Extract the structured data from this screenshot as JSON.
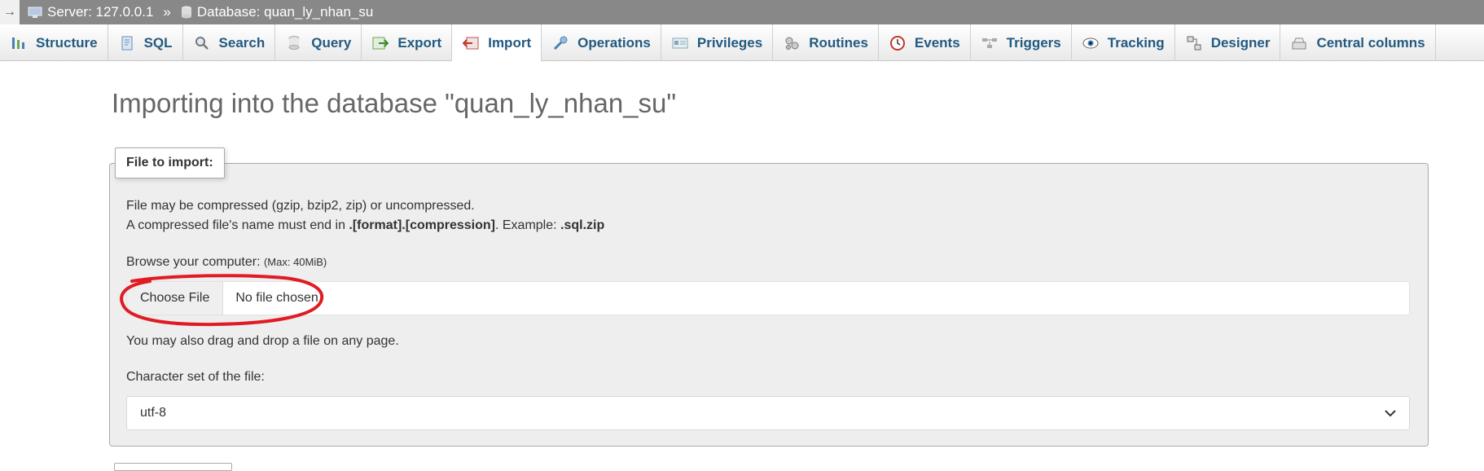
{
  "breadcrumb": {
    "server_label": "Server: 127.0.0.1",
    "separator": "»",
    "database_label": "Database: quan_ly_nhan_su"
  },
  "tabs": [
    {
      "label": "Structure",
      "icon": "structure-icon"
    },
    {
      "label": "SQL",
      "icon": "sql-icon"
    },
    {
      "label": "Search",
      "icon": "search-icon"
    },
    {
      "label": "Query",
      "icon": "query-icon"
    },
    {
      "label": "Export",
      "icon": "export-icon"
    },
    {
      "label": "Import",
      "icon": "import-icon",
      "active": true
    },
    {
      "label": "Operations",
      "icon": "wrench-icon"
    },
    {
      "label": "Privileges",
      "icon": "privileges-icon"
    },
    {
      "label": "Routines",
      "icon": "routines-icon"
    },
    {
      "label": "Events",
      "icon": "clock-icon"
    },
    {
      "label": "Triggers",
      "icon": "triggers-icon"
    },
    {
      "label": "Tracking",
      "icon": "eye-icon"
    },
    {
      "label": "Designer",
      "icon": "designer-icon"
    },
    {
      "label": "Central columns",
      "icon": "central-columns-icon"
    }
  ],
  "page": {
    "title": "Importing into the database \"quan_ly_nhan_su\""
  },
  "file_import": {
    "legend": "File to import:",
    "compress_note": "File may be compressed (gzip, bzip2, zip) or uncompressed.",
    "name_note_prefix": "A compressed file's name must end in ",
    "name_note_format": ".[format].[compression]",
    "name_note_mid": ". Example: ",
    "name_note_example": ".sql.zip",
    "browse_label": "Browse your computer:",
    "max_size": "(Max: 40MiB)",
    "choose_button": "Choose File",
    "file_status": "No file chosen",
    "drag_drop_note": "You may also drag and drop a file on any page.",
    "charset_label": "Character set of the file:",
    "charset_value": "utf-8"
  },
  "colors": {
    "tab_text": "#235a81",
    "breadcrumb_bg": "#888888",
    "annotation": "#e01b24"
  }
}
